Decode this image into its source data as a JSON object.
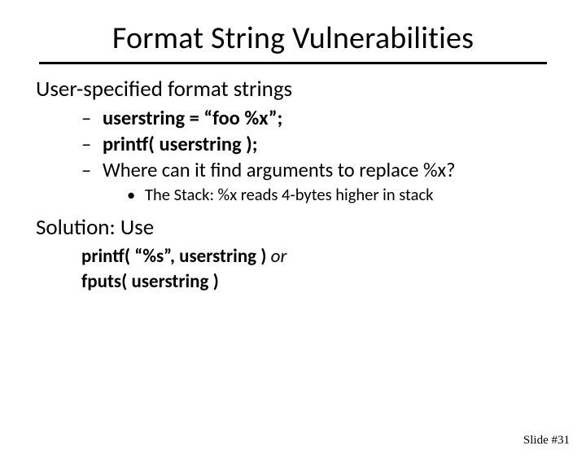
{
  "title": "Format String Vulnerabilities",
  "section1": "User-specified format strings",
  "bullets": {
    "b1": "userstring = “foo %x”;",
    "b2": "printf( userstring );",
    "b3": "Where can it find arguments to replace %x?"
  },
  "sub": "The Stack: %x reads 4-bytes higher in stack",
  "section2": "Solution: Use",
  "code": {
    "line1a": "printf( “%s”, userstring ) ",
    "line1b": "or",
    "line2": "fputs( userstring )"
  },
  "footer": "Slide #31"
}
